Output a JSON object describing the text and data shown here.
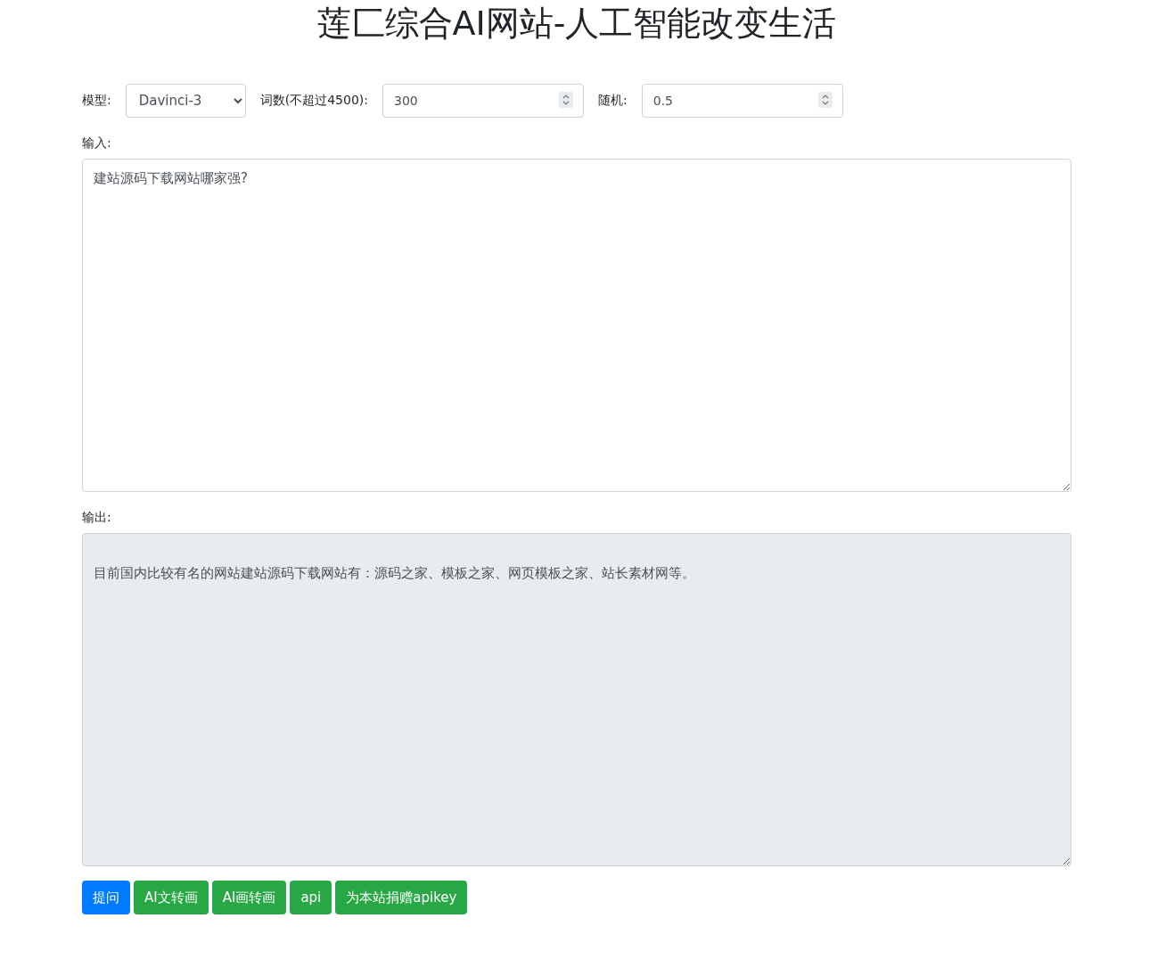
{
  "title": "莲匚综合AI网站-人工智能改变生活",
  "settings": [
    {
      "kind": "select",
      "label": "模型:",
      "value": "Davinci-3"
    },
    {
      "kind": "number",
      "label": "词数(不超过4500):",
      "value": "300"
    },
    {
      "kind": "number",
      "label": "随机:",
      "value": "0.5"
    }
  ],
  "input": {
    "label": "输入:",
    "value": "建站源码下载网站哪家强?"
  },
  "output": {
    "label": "输出:",
    "value": "目前国内比较有名的网站建站源码下载网站有：源码之家、模板之家、网页模板之家、站长素材网等。",
    "disabled": true
  },
  "buttons": [
    {
      "label": "提问",
      "kind": "primary"
    },
    {
      "label": "AI文转画",
      "kind": "success"
    },
    {
      "label": "AI画转画",
      "kind": "success"
    },
    {
      "label": "api",
      "kind": "success"
    },
    {
      "label": "为本站捐赠apikey",
      "kind": "success"
    }
  ]
}
